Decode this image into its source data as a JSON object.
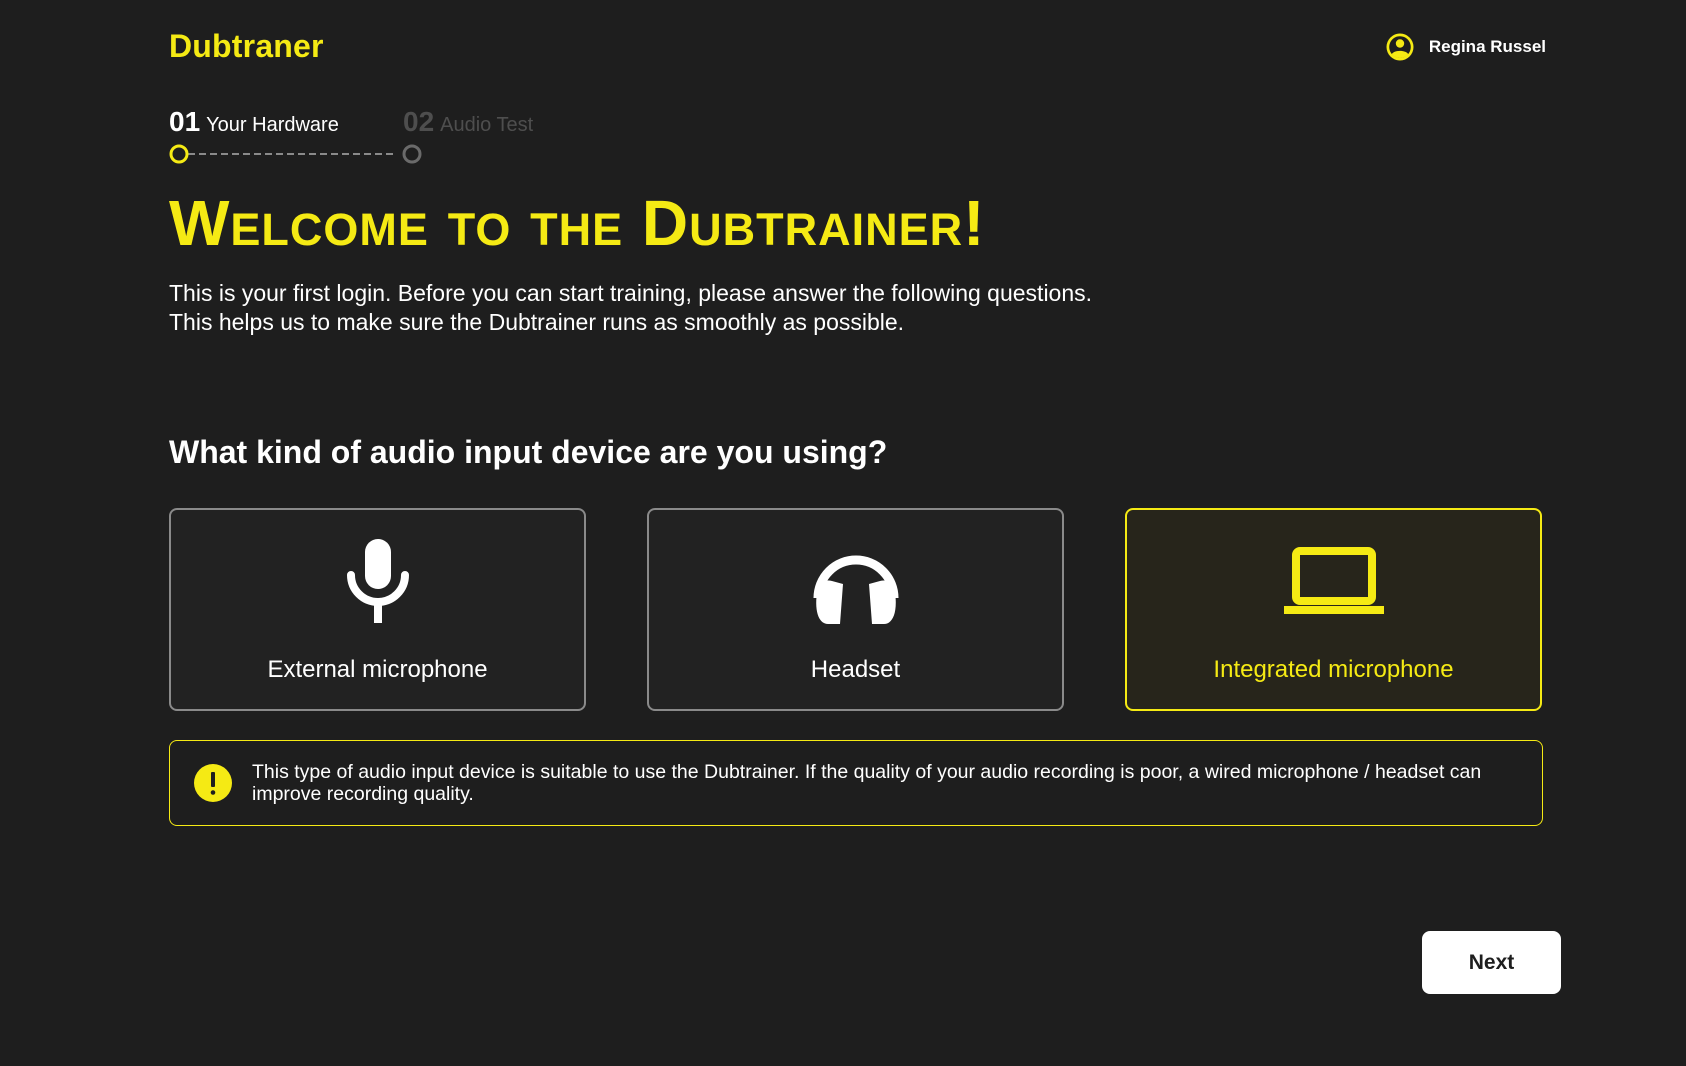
{
  "header": {
    "brand": "Dubtraner",
    "user_name": "Regina Russel",
    "user_icon": "user-circle-icon"
  },
  "stepper": {
    "steps": [
      {
        "number": "01",
        "label": "Your Hardware",
        "state": "active"
      },
      {
        "number": "02",
        "label": "Audio Test",
        "state": "inactive"
      }
    ]
  },
  "main": {
    "heading": "Welcome to the Dubtrainer!",
    "intro_line1": "This is your first login. Before you can start training, please answer the following questions.",
    "intro_line2": "This helps us to make sure the Dubtrainer runs as smoothly as possible.",
    "question": "What kind of audio input device are you using?",
    "options": [
      {
        "label": "External microphone",
        "icon": "microphone-icon",
        "selected": false
      },
      {
        "label": "Headset",
        "icon": "headphones-icon",
        "selected": false
      },
      {
        "label": "Integrated microphone",
        "icon": "laptop-icon",
        "selected": true
      }
    ],
    "notice": {
      "icon": "warning-icon",
      "text": "This type of audio input device is suitable to use the Dubtrainer. If the quality of your audio recording is poor, a wired microphone / headset can improve recording quality."
    }
  },
  "footer": {
    "next_label": "Next"
  },
  "colors": {
    "background": "#1e1e1e",
    "accent": "#f5ea14",
    "border_default": "#8a8a8a",
    "muted": "#4e4e4e"
  }
}
